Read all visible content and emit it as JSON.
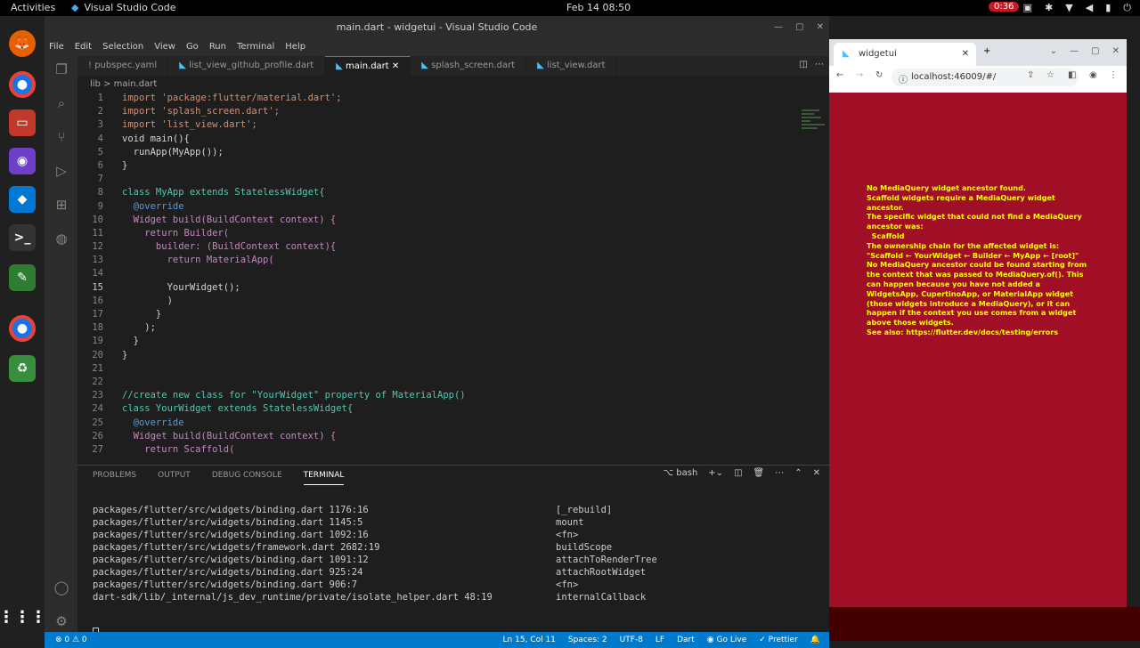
{
  "topbar": {
    "activities": "Activities",
    "app_name": "Visual Studio Code",
    "clock": "Feb 14  08:50",
    "recording": "0:36"
  },
  "vscode": {
    "title": "main.dart - widgetui - Visual Studio Code",
    "menu": [
      "File",
      "Edit",
      "Selection",
      "View",
      "Go",
      "Run",
      "Terminal",
      "Help"
    ],
    "tabs": [
      "pubspec.yaml",
      "list_view_github_profile.dart",
      "main.dart",
      "splash_screen.dart",
      "list_view.dart"
    ],
    "breadcrumb": "lib  >  main.dart",
    "lines": [
      "import 'package:flutter/material.dart';",
      "import 'splash_screen.dart';",
      "import 'list_view.dart';",
      "void main(){",
      "  runApp(MyApp());",
      "}",
      "",
      "class MyApp extends StatelessWidget{",
      "  @override",
      "  Widget build(BuildContext context) {",
      "    return Builder(",
      "      builder: (BuildContext context){",
      "        return MaterialApp(",
      "",
      "        YourWidget();",
      "        )",
      "      }",
      "    );",
      "  }",
      "}",
      "",
      "",
      "//create new class for \"YourWidget\" property of MaterialApp()",
      "class YourWidget extends StatelessWidget{",
      "  @override",
      "  Widget build(BuildContext context) {",
      "    return Scaffold("
    ],
    "panel_tabs": [
      "PROBLEMS",
      "OUTPUT",
      "DEBUG CONSOLE",
      "TERMINAL"
    ],
    "shell": "bash",
    "terminal_left": [
      "packages/flutter/src/widgets/binding.dart 1176:16",
      "packages/flutter/src/widgets/binding.dart 1145:5",
      "packages/flutter/src/widgets/binding.dart 1092:16",
      "packages/flutter/src/widgets/framework.dart 2682:19",
      "packages/flutter/src/widgets/binding.dart 1091:12",
      "packages/flutter/src/widgets/binding.dart 925:24",
      "packages/flutter/src/widgets/binding.dart 906:7",
      "dart-sdk/lib/_internal/js_dev_runtime/private/isolate_helper.dart 48:19"
    ],
    "terminal_right": [
      "[_rebuild]",
      "mount",
      "<fn>",
      "buildScope",
      "attachToRenderTree",
      "attachRootWidget",
      "<fn>",
      "internalCallback"
    ],
    "status_left": "⊗ 0  ⚠ 0",
    "status_right": [
      "Ln 15, Col 11",
      "Spaces: 2",
      "UTF-8",
      "LF",
      "Dart",
      "Go Live",
      "Prettier"
    ]
  },
  "browser": {
    "tab_title": "widgetui",
    "url": "localhost:46009/#/",
    "error_text": "No MediaQuery widget ancestor found.\nScaffold widgets require a MediaQuery widget ancestor.\nThe specific widget that could not find a MediaQuery ancestor was:\n  Scaffold\nThe ownership chain for the affected widget is: \"Scaffold ← YourWidget ← Builder ← MyApp ← [root]\"\nNo MediaQuery ancestor could be found starting from the context that was passed to MediaQuery.of(). This can happen because you have not added a WidgetsApp, CupertinoApp, or MaterialApp widget (those widgets introduce a MediaQuery), or it can happen if the context you use comes from a widget above those widgets.\nSee also: https://flutter.dev/docs/testing/errors"
  },
  "colors": {
    "accent": "#007acc",
    "error_bg": "#a00f26",
    "error_text": "#ffff00"
  }
}
